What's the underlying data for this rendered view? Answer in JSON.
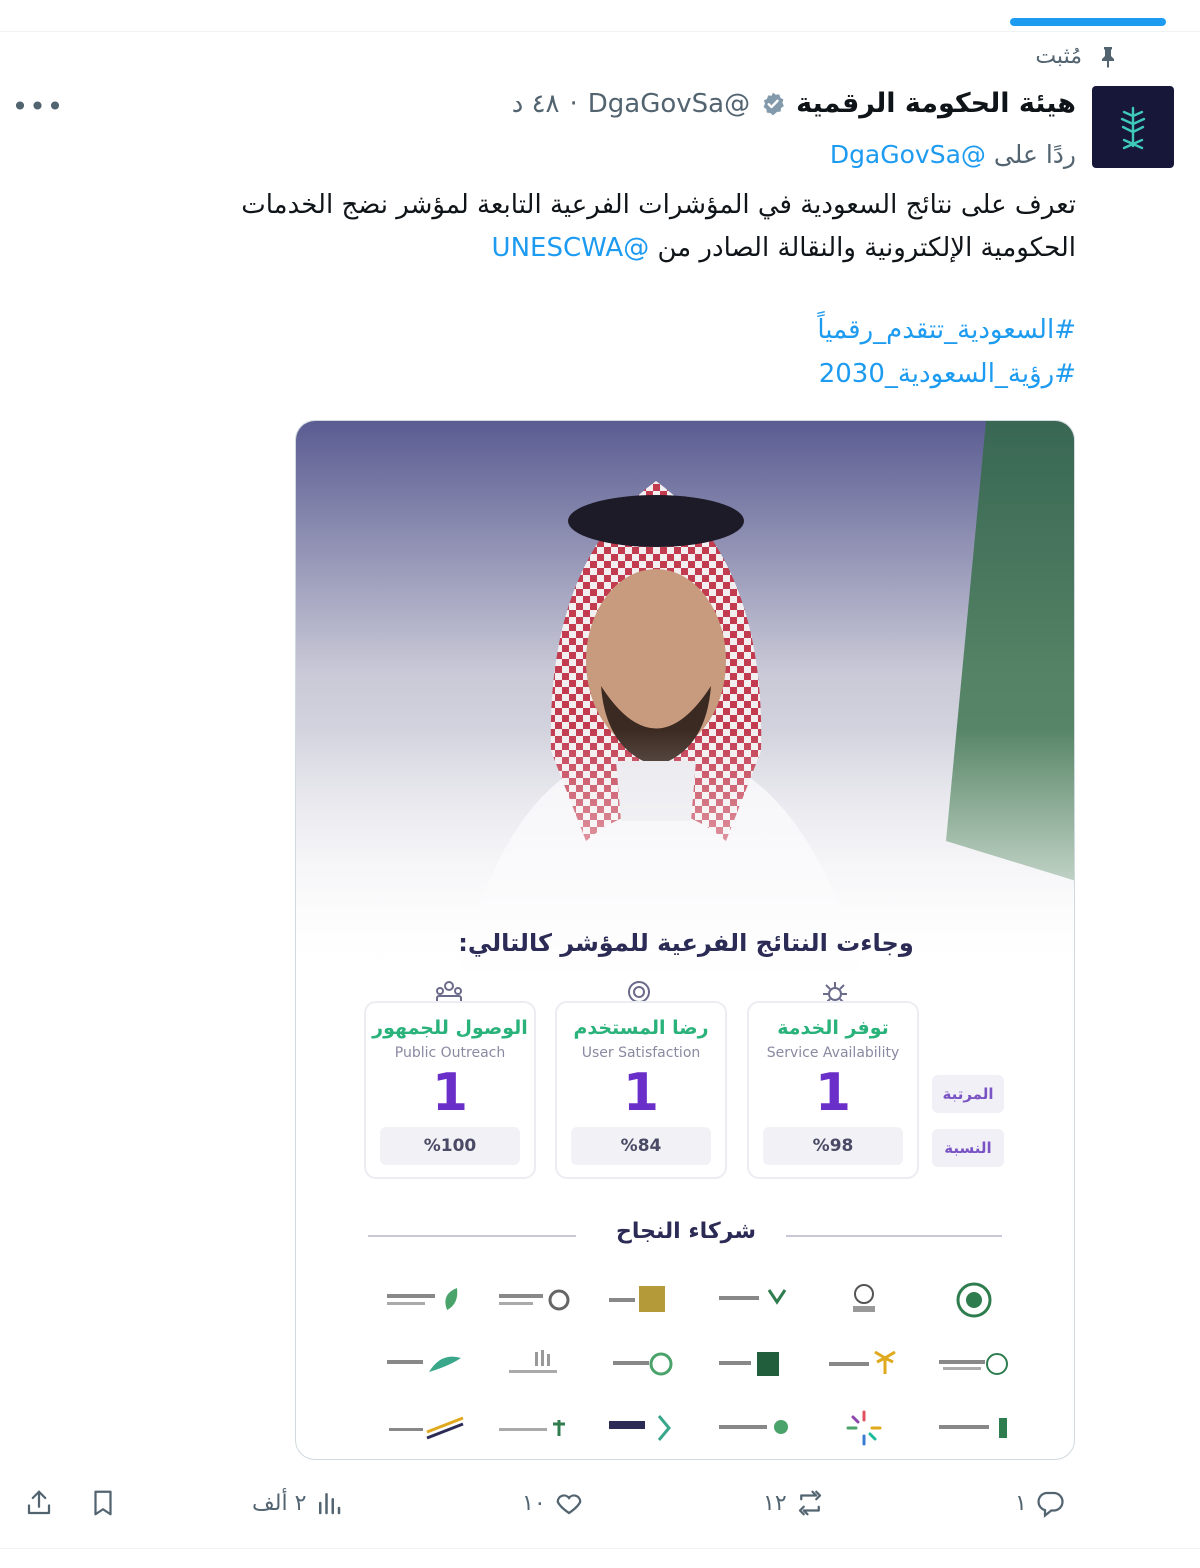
{
  "pinned_label": "مُثبت",
  "author": {
    "display_name": "هيئة الحكومة الرقمية",
    "handle": "@DgaGovSa",
    "separator": "·",
    "time": "٤٨ د"
  },
  "reply": {
    "prefix": "ردًا على",
    "mention": "@DgaGovSa"
  },
  "tweet": {
    "line1": "تعرف على نتائج السعودية في المؤشرات الفرعية التابعة لمؤشر نضج الخدمات",
    "line2_text": "الحكومية الإلكترونية والنقالة الصادر من",
    "line2_mention": "@UNESCWA",
    "hashtag1": "#السعودية_تتقدم_رقمياً",
    "hashtag2": "#رؤية_السعودية_2030"
  },
  "card": {
    "title": "وجاءت النتائج الفرعية للمؤشر كالتالي:",
    "rank_label": "المرتبة",
    "percent_label": "النسبة",
    "metrics": [
      {
        "ar": "توفر الخدمة",
        "en": "Service Availability",
        "rank": "1",
        "percent": "%98"
      },
      {
        "ar": "رضا المستخدم",
        "en": "User Satisfaction",
        "rank": "1",
        "percent": "%84"
      },
      {
        "ar": "الوصول للجمهور",
        "en": "Public Outreach",
        "rank": "1",
        "percent": "%100"
      }
    ],
    "partners_title": "شركاء النجاح"
  },
  "actions": {
    "replies": "١",
    "reposts": "١٢",
    "likes": "١٠",
    "views": "٢ ألف"
  },
  "colors": {
    "accent": "#1d9bf0",
    "muted": "#536471",
    "card_purple": "#6b2fc9",
    "card_green": "#2ab27b"
  }
}
